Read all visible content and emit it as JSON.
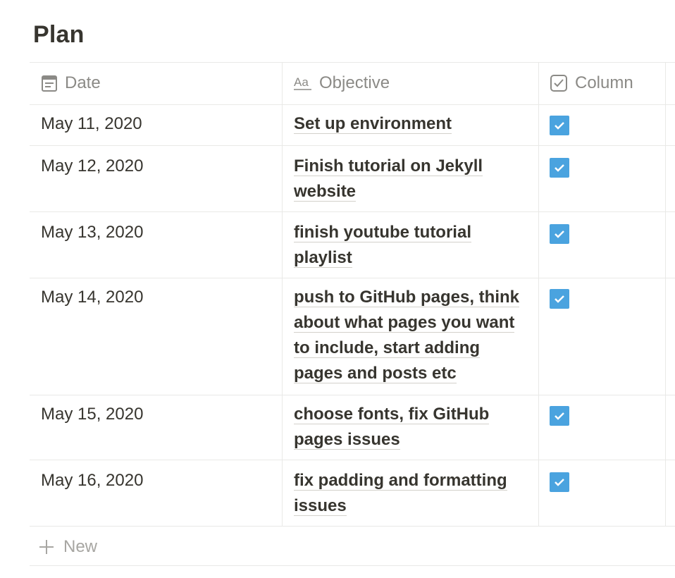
{
  "page": {
    "title": "Plan"
  },
  "table": {
    "columns": [
      {
        "label": "Date",
        "icon": "calendar-icon"
      },
      {
        "label": "Objective",
        "icon": "text-aa-icon"
      },
      {
        "label": "Column",
        "icon": "checkbox-icon"
      }
    ],
    "rows": [
      {
        "date": "May 11, 2020",
        "objective": "Set up environment",
        "checked": true
      },
      {
        "date": "May 12, 2020",
        "objective": "Finish tutorial on Jekyll website",
        "checked": true
      },
      {
        "date": "May 13, 2020",
        "objective": "finish youtube tutorial playlist",
        "checked": true
      },
      {
        "date": "May 14, 2020",
        "objective": "push to GitHub pages, think about what pages you want to include, start adding pages and posts etc",
        "checked": true
      },
      {
        "date": "May 15, 2020",
        "objective": "choose fonts, fix GitHub pages issues",
        "checked": true
      },
      {
        "date": "May 16, 2020",
        "objective": "fix padding and formatting issues",
        "checked": true
      }
    ],
    "new_label": "New"
  },
  "colors": {
    "checkbox": "#4aa3df",
    "text": "#37352f",
    "muted": "#8b8a86",
    "border": "#e9e9e7"
  }
}
